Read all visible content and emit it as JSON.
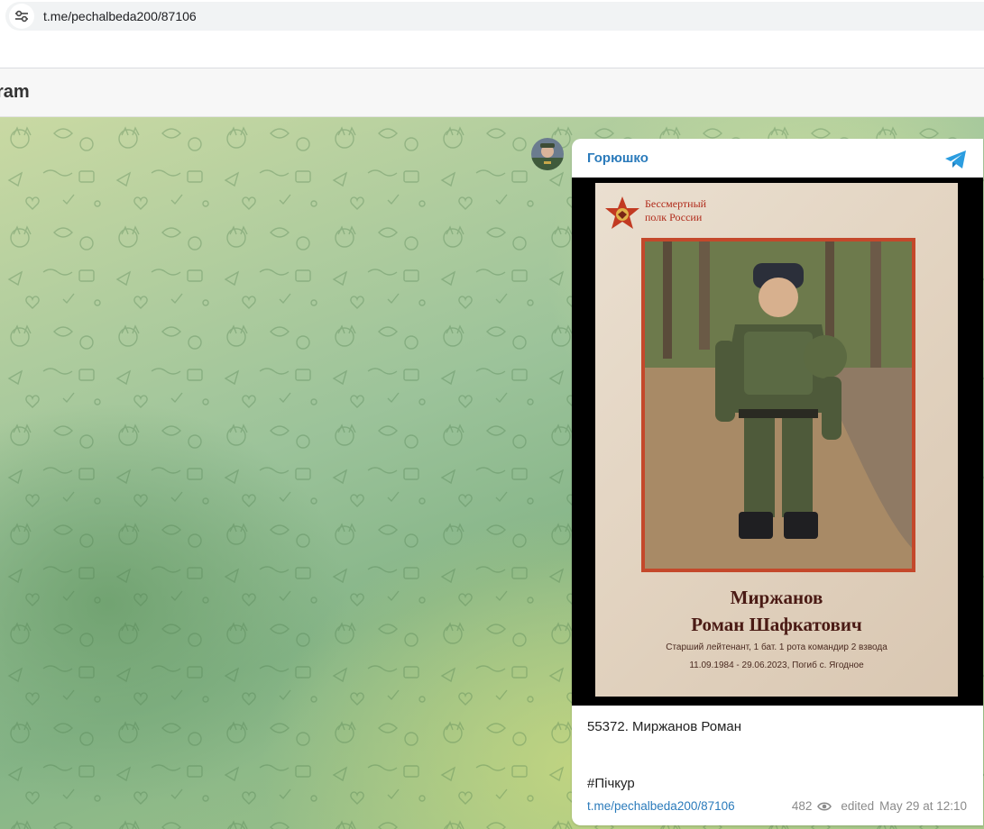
{
  "browser": {
    "url": "t.me/pechalbeda200/87106"
  },
  "header": {
    "title": "ram"
  },
  "post": {
    "author": "Горюшко",
    "poster": {
      "org_line1": "Бессмертный",
      "org_line2": "полк России",
      "name_line1": "Миржанов",
      "name_line2": "Роман Шафкатович",
      "rank": "Старший лейтенант, 1 бат. 1 рота командир 2 взвода",
      "dates": "11.09.1984 - 29.06.2023, Погиб с. Ягодное"
    },
    "caption": "55372. Миржанов Роман",
    "hashtag": "#Пічкур",
    "link": "t.me/pechalbeda200/87106",
    "views": "482",
    "edited": "edited",
    "date": "May 29 at 12:10"
  },
  "colors": {
    "link": "#2b7bbb",
    "poster_red": "#c4482b"
  },
  "icons": {
    "site_info": "tune-icon",
    "telegram": "telegram-logo-icon",
    "views": "eye-icon"
  }
}
